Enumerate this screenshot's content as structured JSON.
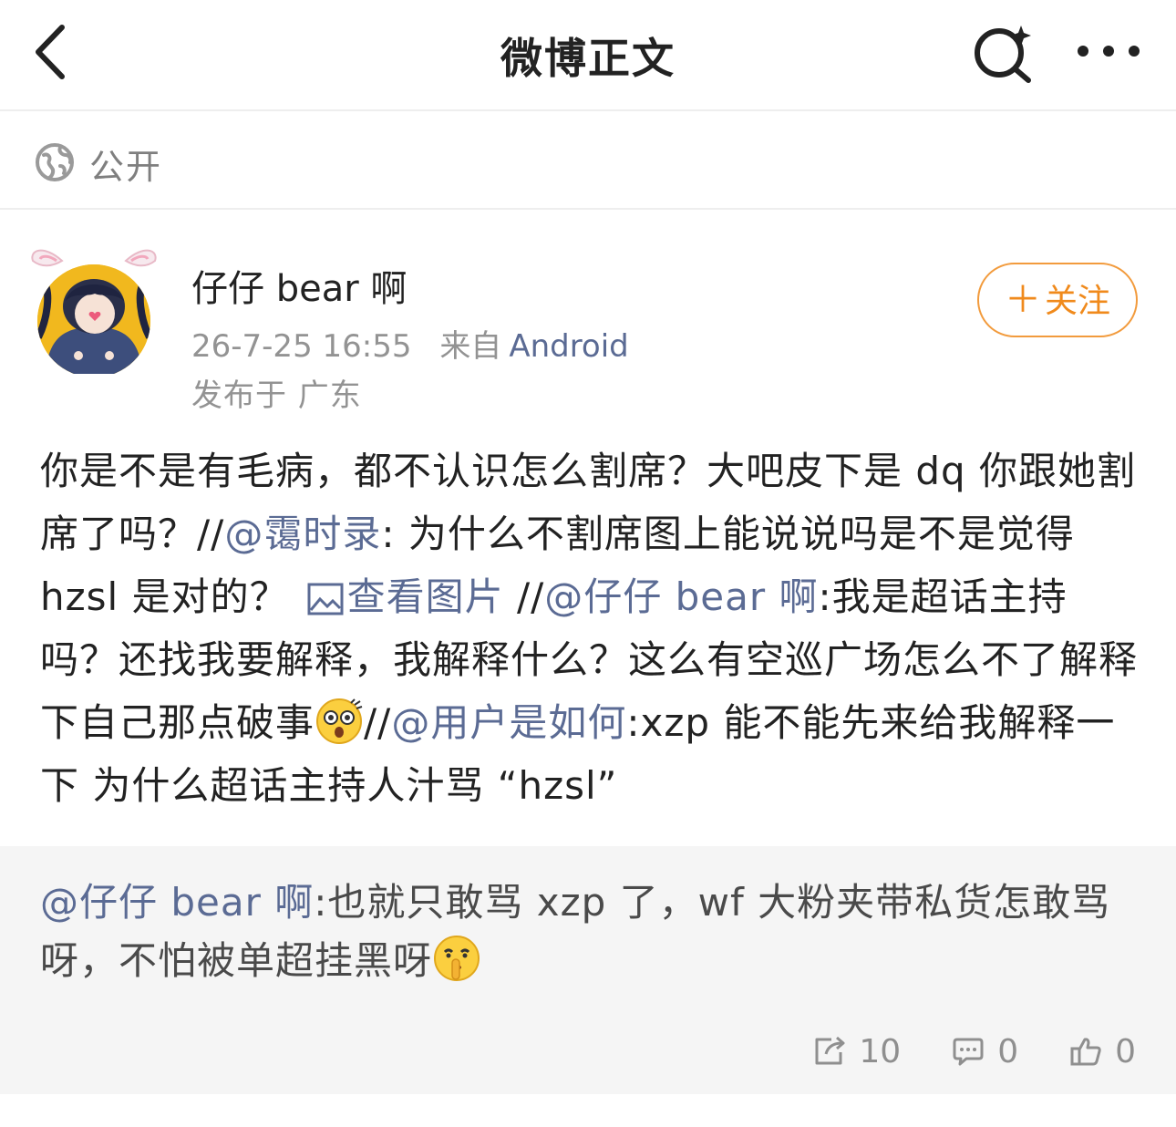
{
  "header": {
    "title": "微博正文",
    "back_icon": "chevron-left-icon",
    "search_icon": "search-sparkle-icon",
    "more_icon": "more-dots-icon"
  },
  "visibility": {
    "icon": "globe-icon",
    "label": "公开"
  },
  "post": {
    "author": "仔仔 bear 啊",
    "time": "26-7-25 16:55",
    "from_label": "来自",
    "source": "Android",
    "location": "发布于 广东",
    "follow_label": "关注",
    "body": {
      "t1": "你是不是有毛病，都不认识怎么割席？大吧皮下是 dq 你跟她割席了吗？//",
      "m1": "@霭时录",
      "t2": ": 为什么不割席图上能说说吗是不是觉得 hzsl 是对的？",
      "img_link": "查看图片",
      "t3": " //",
      "m2": "@仔仔 bear 啊",
      "t4": ":我是超话主持吗？还找我要解释，我解释什么？这么有空巡广场怎么不了解释下自己那点破事",
      "t5": "//",
      "m3": "@用户是如何",
      "t6": ":xzp 能不能先来给我解释一下 为什么超话主持人汁骂 “hzsl”"
    }
  },
  "repost": {
    "mention": "@仔仔 bear 啊",
    "text": ":也就只敢骂 xzp 了，wf 大粉夹带私货怎敢骂呀，不怕被单超挂黑呀",
    "emoji": "shushing-face-emoji"
  },
  "actions": {
    "share_count": "10",
    "comment_count": "0",
    "like_count": "0"
  },
  "colors": {
    "accent_orange": "#f08a1c",
    "mention_blue": "#5b6b94",
    "muted": "#939393"
  }
}
